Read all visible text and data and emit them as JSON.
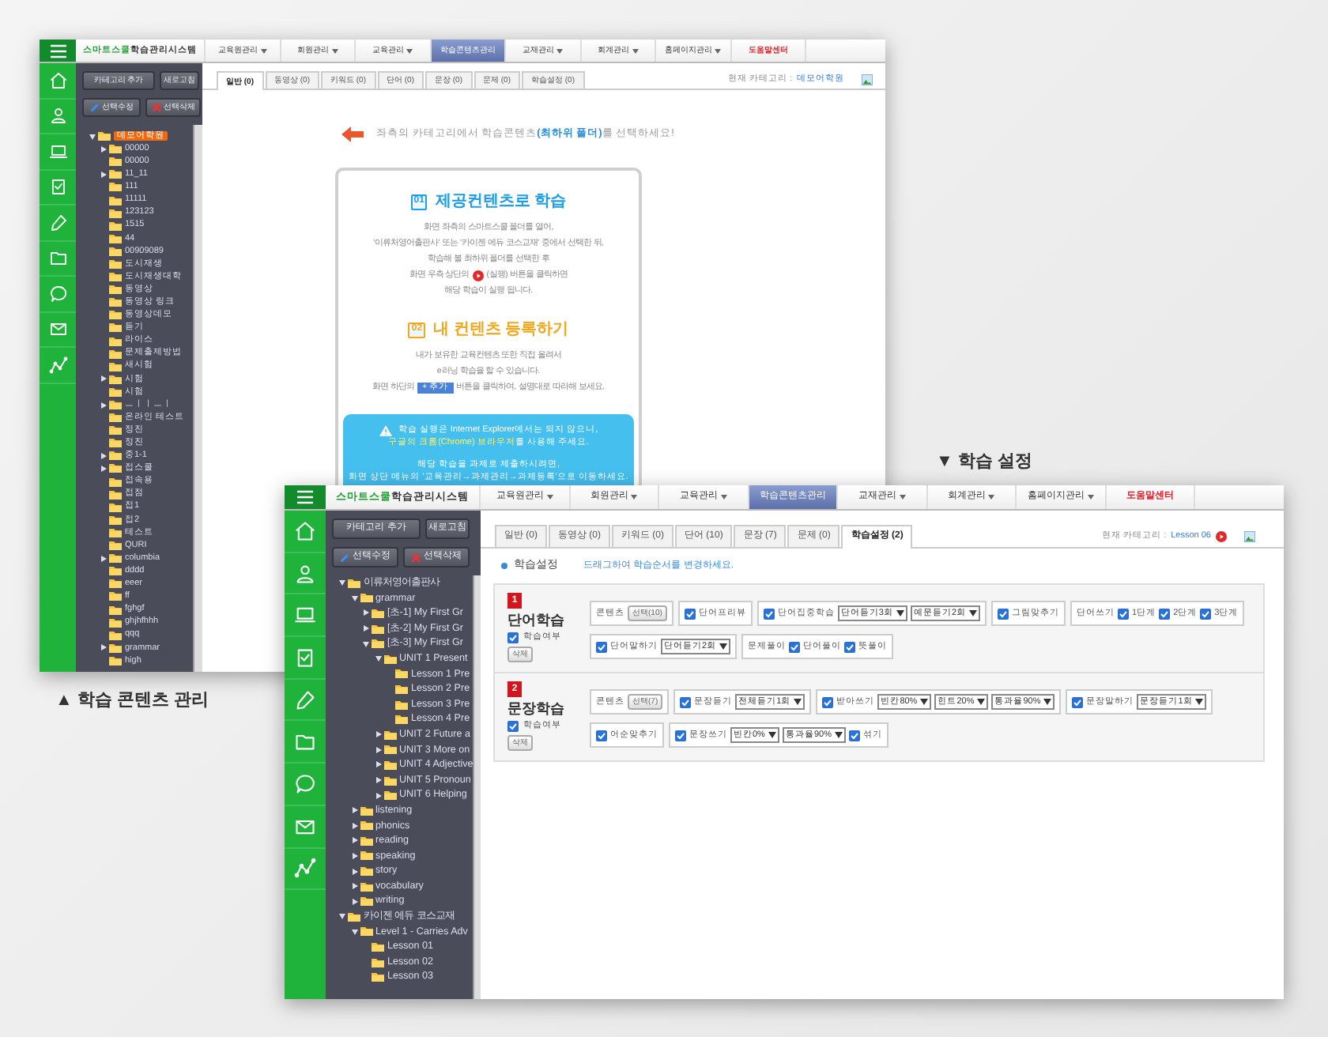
{
  "content_window": {
    "logo": {
      "brand": "스마트스쿨",
      "title": "학습관리시스템"
    },
    "menu": [
      {
        "label": "교육원관리",
        "kind": "dropdown",
        "selected": false
      },
      {
        "label": "회원관리",
        "kind": "dropdown",
        "selected": false
      },
      {
        "label": "교육관리",
        "kind": "dropdown",
        "selected": false
      },
      {
        "label": "학습콘텐츠관리",
        "kind": "plain",
        "selected": true
      },
      {
        "label": "교재관리",
        "kind": "dropdown",
        "selected": false
      },
      {
        "label": "회계관리",
        "kind": "dropdown",
        "selected": false
      },
      {
        "label": "홈페이지관리",
        "kind": "dropdown",
        "selected": false
      },
      {
        "label": "도움말센터",
        "kind": "help",
        "selected": false
      }
    ],
    "tree_buttons": [
      {
        "label": "카테고리 추가",
        "kind": "plain"
      },
      {
        "label": "새로고침",
        "kind": "plain"
      },
      {
        "label": "선택수정",
        "kind": "edit"
      },
      {
        "label": "선택삭제",
        "kind": "delete"
      }
    ],
    "tree": [
      {
        "label": "데모어학원",
        "selected": true,
        "expanded": true,
        "children": [
          {
            "label": "00000",
            "selected": false,
            "expanded": false
          },
          {
            "label": "00000",
            "selected": false
          },
          {
            "label": "11_11",
            "selected": false,
            "expanded": false
          },
          {
            "label": "111",
            "selected": false
          },
          {
            "label": "11111",
            "selected": false
          },
          {
            "label": "123123",
            "selected": false
          },
          {
            "label": "1515",
            "selected": false
          },
          {
            "label": "44",
            "selected": false
          },
          {
            "label": "00909089",
            "selected": false
          },
          {
            "label": "도시재생",
            "selected": false
          },
          {
            "label": "도시재생대학",
            "selected": false
          },
          {
            "label": "동영상",
            "selected": false
          },
          {
            "label": "동영상 링크",
            "selected": false
          },
          {
            "label": "동영상데모",
            "selected": false
          },
          {
            "label": "듣기",
            "selected": false
          },
          {
            "label": "라이스",
            "selected": false
          },
          {
            "label": "문제출제방법",
            "selected": false
          },
          {
            "label": "새시험",
            "selected": false
          },
          {
            "label": "시험",
            "selected": false,
            "expanded": false
          },
          {
            "label": "시험",
            "selected": false
          },
          {
            "label": "ㅡㅣㅣㅡㅣ",
            "selected": false,
            "expanded": false
          },
          {
            "label": "온라인 테스트",
            "selected": false
          },
          {
            "label": "정진",
            "selected": false
          },
          {
            "label": "정진",
            "selected": false
          },
          {
            "label": "중1-1",
            "selected": false,
            "expanded": false
          },
          {
            "label": "접스쿨",
            "selected": false,
            "expanded": false
          },
          {
            "label": "접속용",
            "selected": false
          },
          {
            "label": "접점",
            "selected": false
          },
          {
            "label": "접1",
            "selected": false
          },
          {
            "label": "접2",
            "selected": false
          },
          {
            "label": "테스트",
            "selected": false
          },
          {
            "label": "QURI",
            "selected": false
          },
          {
            "label": "columbia",
            "selected": false,
            "expanded": false
          },
          {
            "label": "dddd",
            "selected": false
          },
          {
            "label": "eeer",
            "selected": false
          },
          {
            "label": "ff",
            "selected": false
          },
          {
            "label": "fghgf",
            "selected": false
          },
          {
            "label": "ghjhfhhh",
            "selected": false
          },
          {
            "label": "qqq",
            "selected": false
          },
          {
            "label": "grammar",
            "selected": false,
            "expanded": false
          },
          {
            "label": "high",
            "selected": false
          }
        ]
      }
    ],
    "tabs": [
      {
        "label": "일반 (0)",
        "selected": true
      },
      {
        "label": "동영상 (0)",
        "selected": false
      },
      {
        "label": "키워드 (0)",
        "selected": false
      },
      {
        "label": "단어 (0)",
        "selected": false
      },
      {
        "label": "문장 (0)",
        "selected": false
      },
      {
        "label": "문제 (0)",
        "selected": false
      },
      {
        "label": "학습설정 (0)",
        "selected": false
      }
    ],
    "current_category": {
      "label": "현재 카테고리 :",
      "value": "데모어학원",
      "run_button": false
    },
    "instruction": [
      {
        "text": "좌측의 카테고리에서 학습콘텐츠",
        "highlight": false
      },
      {
        "text": "(최하위 폴더)",
        "highlight": true
      },
      {
        "text": "를 선택하세요!",
        "highlight": false
      }
    ],
    "steps": [
      {
        "number": "01",
        "title": "제공컨텐츠로 학습",
        "color": "#1e9ee6",
        "lines": [
          [
            {
              "kind": "text",
              "text": "화면 좌측의 스마트스쿨 폴더를 열어,"
            }
          ],
          [
            {
              "kind": "text",
              "text": "'이류처영어출판사' 또는 '카이젠 에듀 코스교재' 중에서 선택한 뒤,"
            }
          ],
          [
            {
              "kind": "text",
              "text": "학습해 볼 최하위 폴더를 선택한 후"
            }
          ],
          [
            {
              "kind": "text",
              "text": "화면 우측 상단의"
            },
            {
              "kind": "play_button"
            },
            {
              "kind": "text",
              "text": "(실행) 버튼을 클릭하면"
            }
          ],
          [
            {
              "kind": "text",
              "text": "해당 학습이 실행 됩니다."
            }
          ]
        ]
      },
      {
        "number": "02",
        "title": "내 컨텐츠 등록하기",
        "color": "#f0a81c",
        "lines": [
          [
            {
              "kind": "text",
              "text": "내가 보유한 교육컨텐츠 또한 직접 올려서"
            }
          ],
          [
            {
              "kind": "text",
              "text": "e러닝 학습을 할 수 있습니다."
            }
          ],
          [
            {
              "kind": "text",
              "text": "화면 하단의"
            },
            {
              "kind": "button",
              "text": "+ 추가"
            },
            {
              "kind": "text",
              "text": "버튼을 클릭하여, 설명대로 따라해 보세요."
            }
          ]
        ]
      }
    ],
    "notice": [
      [
        {
          "text": "학습 실행은 Internet Explorer에서는 되지 않으니,",
          "highlight": false
        }
      ],
      [
        {
          "text": "구글의 크롬(Chrome) 브라우저",
          "highlight": true
        },
        {
          "text": "를 사용해 주세요.",
          "highlight": false
        }
      ],
      [
        {
          "text": "해당 학습을 과제로 제출하시려면,",
          "highlight": false
        }
      ],
      [
        {
          "text": "화면 상단 메뉴의 '교육관리→과제관리→과제등록'으로 이동하세요.",
          "highlight": false
        }
      ]
    ]
  },
  "settings_caption": "▼ 학습 설정",
  "settings_window": {
    "logo": {
      "brand": "스마트스쿨",
      "title": "학습관리시스템"
    },
    "menu": [
      {
        "label": "교육원관리",
        "kind": "dropdown",
        "selected": false
      },
      {
        "label": "회원관리",
        "kind": "dropdown",
        "selected": false
      },
      {
        "label": "교육관리",
        "kind": "dropdown",
        "selected": false
      },
      {
        "label": "학습콘텐츠관리",
        "kind": "plain",
        "selected": true
      },
      {
        "label": "교재관리",
        "kind": "dropdown",
        "selected": false
      },
      {
        "label": "회계관리",
        "kind": "dropdown",
        "selected": false
      },
      {
        "label": "홈페이지관리",
        "kind": "dropdown",
        "selected": false
      },
      {
        "label": "도움말센터",
        "kind": "help",
        "selected": false
      }
    ],
    "tree_buttons": [
      {
        "label": "카테고리 추가",
        "kind": "plain"
      },
      {
        "label": "새로고침",
        "kind": "plain"
      },
      {
        "label": "선택수정",
        "kind": "edit"
      },
      {
        "label": "선택삭제",
        "kind": "delete"
      }
    ],
    "tree": [
      {
        "label": "이류처영어출판사",
        "selected": false,
        "expanded": true,
        "children": [
          {
            "label": "grammar",
            "selected": false,
            "expanded": true,
            "children": [
              {
                "label": "[초-1] My First Gr",
                "selected": false,
                "expanded": false
              },
              {
                "label": "[초-2] My First Gr",
                "selected": false,
                "expanded": false
              },
              {
                "label": "[초-3] My First Gr",
                "selected": false,
                "expanded": true,
                "children": [
                  {
                    "label": "UNIT 1 Present",
                    "selected": false,
                    "expanded": true,
                    "children": [
                      {
                        "label": "Lesson 1 Pre",
                        "selected": false
                      },
                      {
                        "label": "Lesson 2 Pre",
                        "selected": false
                      },
                      {
                        "label": "Lesson 3 Pre",
                        "selected": false
                      },
                      {
                        "label": "Lesson 4 Pre",
                        "selected": false
                      }
                    ]
                  },
                  {
                    "label": "UNIT 2 Future a",
                    "selected": false,
                    "expanded": false
                  },
                  {
                    "label": "UNIT 3 More on",
                    "selected": false,
                    "expanded": false
                  },
                  {
                    "label": "UNIT 4 Adjective",
                    "selected": false,
                    "expanded": false
                  },
                  {
                    "label": "UNIT 5 Pronoun",
                    "selected": false,
                    "expanded": false
                  },
                  {
                    "label": "UNIT 6 Helping",
                    "selected": false,
                    "expanded": false
                  }
                ]
              }
            ]
          },
          {
            "label": "listening",
            "selected": false,
            "expanded": false
          },
          {
            "label": "phonics",
            "selected": false,
            "expanded": false
          },
          {
            "label": "reading",
            "selected": false,
            "expanded": false
          },
          {
            "label": "speaking",
            "selected": false,
            "expanded": false
          },
          {
            "label": "story",
            "selected": false,
            "expanded": false
          },
          {
            "label": "vocabulary",
            "selected": false,
            "expanded": false
          },
          {
            "label": "writing",
            "selected": false,
            "expanded": false
          }
        ]
      },
      {
        "label": "카이젠 에듀 코스교재",
        "selected": false,
        "expanded": true,
        "children": [
          {
            "label": "Level 1 - Carries Adv",
            "selected": false,
            "expanded": true,
            "children": [
              {
                "label": "Lesson 01",
                "selected": false
              },
              {
                "label": "Lesson 02",
                "selected": false
              },
              {
                "label": "Lesson 03",
                "selected": false
              }
            ]
          }
        ]
      }
    ],
    "tabs": [
      {
        "label": "일반 (0)",
        "selected": false
      },
      {
        "label": "동영상 (0)",
        "selected": false
      },
      {
        "label": "키워드 (0)",
        "selected": false
      },
      {
        "label": "단어 (10)",
        "selected": false
      },
      {
        "label": "문장 (7)",
        "selected": false
      },
      {
        "label": "문제 (0)",
        "selected": false
      },
      {
        "label": "학습설정 (2)",
        "selected": true
      }
    ],
    "current_category": {
      "label": "현재 카테고리 :",
      "value": "Lesson 06",
      "run_button": true
    },
    "settings_heading": "학습설정",
    "settings_hint": "드래그하여 학습순서를 변경하세요.",
    "sections": [
      {
        "number": "1",
        "title": "단어학습",
        "enabled_label": "학습여부",
        "enabled": true,
        "delete_label": "삭제",
        "groups": [
          {
            "parts": [
              {
                "kind": "label",
                "text": "콘텐츠"
              },
              {
                "kind": "button",
                "text": "선택(10)"
              }
            ]
          },
          {
            "parts": [
              {
                "kind": "check",
                "text": "단어프리뷰",
                "checked": true
              }
            ]
          },
          {
            "parts": [
              {
                "kind": "check",
                "text": "단어집중학습",
                "checked": true
              },
              {
                "kind": "select",
                "text": "단어듣기3회"
              },
              {
                "kind": "select",
                "text": "예문듣기2회"
              }
            ]
          },
          {
            "parts": [
              {
                "kind": "check",
                "text": "그림맞추기",
                "checked": true
              }
            ]
          },
          {
            "parts": [
              {
                "kind": "label",
                "text": "단어쓰기"
              },
              {
                "kind": "check",
                "text": "1단계",
                "checked": true
              },
              {
                "kind": "check",
                "text": "2단계",
                "checked": true
              },
              {
                "kind": "check",
                "text": "3단계",
                "checked": true
              }
            ]
          },
          {
            "parts": [
              {
                "kind": "check",
                "text": "단어말하기",
                "checked": true
              },
              {
                "kind": "select",
                "text": "단어듣기2회"
              }
            ]
          },
          {
            "parts": [
              {
                "kind": "label",
                "text": "문제풀이"
              },
              {
                "kind": "check",
                "text": "단어풀이",
                "checked": true
              },
              {
                "kind": "check",
                "text": "뜻풀이",
                "checked": true
              }
            ]
          }
        ]
      },
      {
        "number": "2",
        "title": "문장학습",
        "enabled_label": "학습여부",
        "enabled": true,
        "delete_label": "삭제",
        "groups": [
          {
            "parts": [
              {
                "kind": "label",
                "text": "콘텐츠"
              },
              {
                "kind": "button",
                "text": "선택(7)"
              }
            ]
          },
          {
            "parts": [
              {
                "kind": "check",
                "text": "문장듣기",
                "checked": true
              },
              {
                "kind": "select",
                "text": "전체듣기1회"
              }
            ]
          },
          {
            "parts": [
              {
                "kind": "check",
                "text": "받아쓰기",
                "checked": true
              },
              {
                "kind": "select",
                "text": "빈칸80%"
              },
              {
                "kind": "select",
                "text": "힌트20%"
              },
              {
                "kind": "select",
                "text": "통과율90%"
              }
            ]
          },
          {
            "parts": [
              {
                "kind": "check",
                "text": "문장말하기",
                "checked": true
              },
              {
                "kind": "select",
                "text": "문장듣기1회"
              }
            ]
          },
          {
            "parts": [
              {
                "kind": "check",
                "text": "어순맞추기",
                "checked": true
              }
            ]
          },
          {
            "parts": [
              {
                "kind": "check",
                "text": "문장쓰기",
                "checked": true
              },
              {
                "kind": "select",
                "text": "빈칸0%"
              },
              {
                "kind": "select",
                "text": "통과율90%"
              },
              {
                "kind": "check",
                "text": "섞기",
                "checked": true
              }
            ]
          }
        ]
      }
    ]
  },
  "content_caption": "▲ 학습 콘텐츠 관리"
}
